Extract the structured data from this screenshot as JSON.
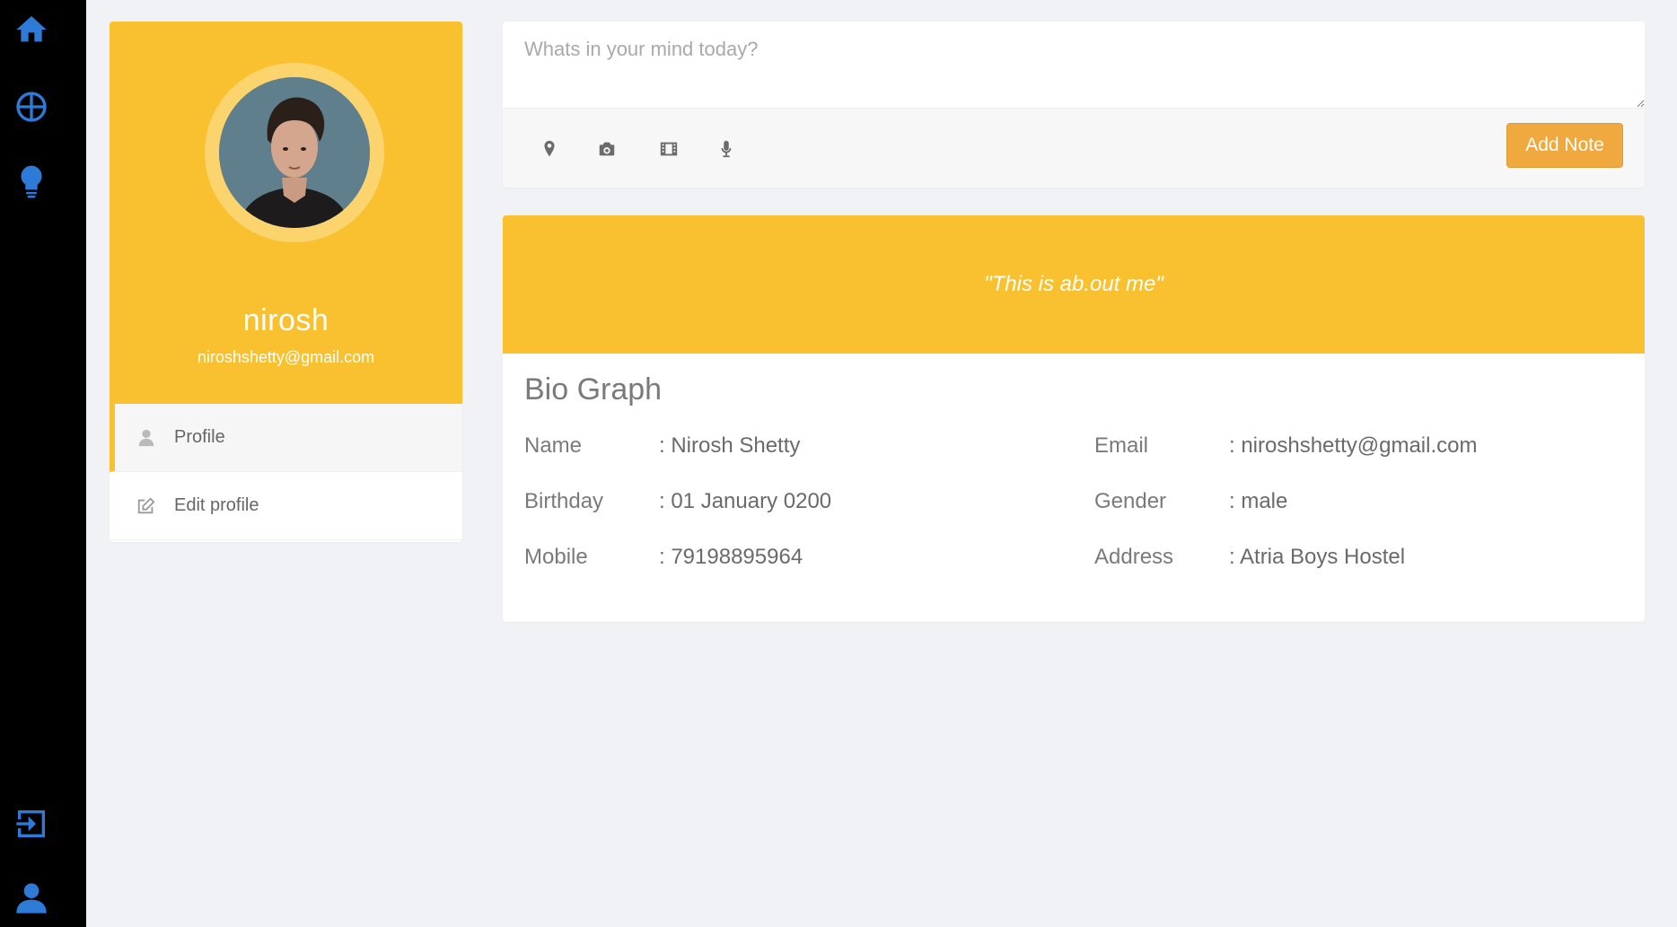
{
  "sidebar": {
    "icons": [
      "home-icon",
      "dashboard-icon",
      "lightbulb-icon",
      "logout-icon",
      "user-icon"
    ],
    "accent": "#2d7bd6"
  },
  "profile": {
    "name": "nirosh",
    "email": "niroshshetty@gmail.com",
    "accent": "#f9c02f",
    "menu": [
      {
        "label": "Profile",
        "icon": "user-icon",
        "active": true
      },
      {
        "label": "Edit profile",
        "icon": "edit-icon",
        "active": false
      }
    ]
  },
  "composer": {
    "placeholder": "Whats in your mind today?",
    "tools": [
      "location-icon",
      "camera-icon",
      "film-icon",
      "microphone-icon"
    ],
    "button_label": "Add Note",
    "button_color": "#f0a93f"
  },
  "bio": {
    "quote": "\"This is ab.out me\"",
    "title": "Bio Graph",
    "fields": {
      "name": {
        "label": "Name",
        "value": ": Nirosh Shetty"
      },
      "email": {
        "label": "Email",
        "value": ": niroshshetty@gmail.com"
      },
      "birthday": {
        "label": "Birthday",
        "value": ": 01 January 0200"
      },
      "gender": {
        "label": "Gender",
        "value": ": male"
      },
      "mobile": {
        "label": "Mobile",
        "value": ": 79198895964"
      },
      "address": {
        "label": "Address",
        "value": ": Atria Boys Hostel"
      }
    }
  }
}
